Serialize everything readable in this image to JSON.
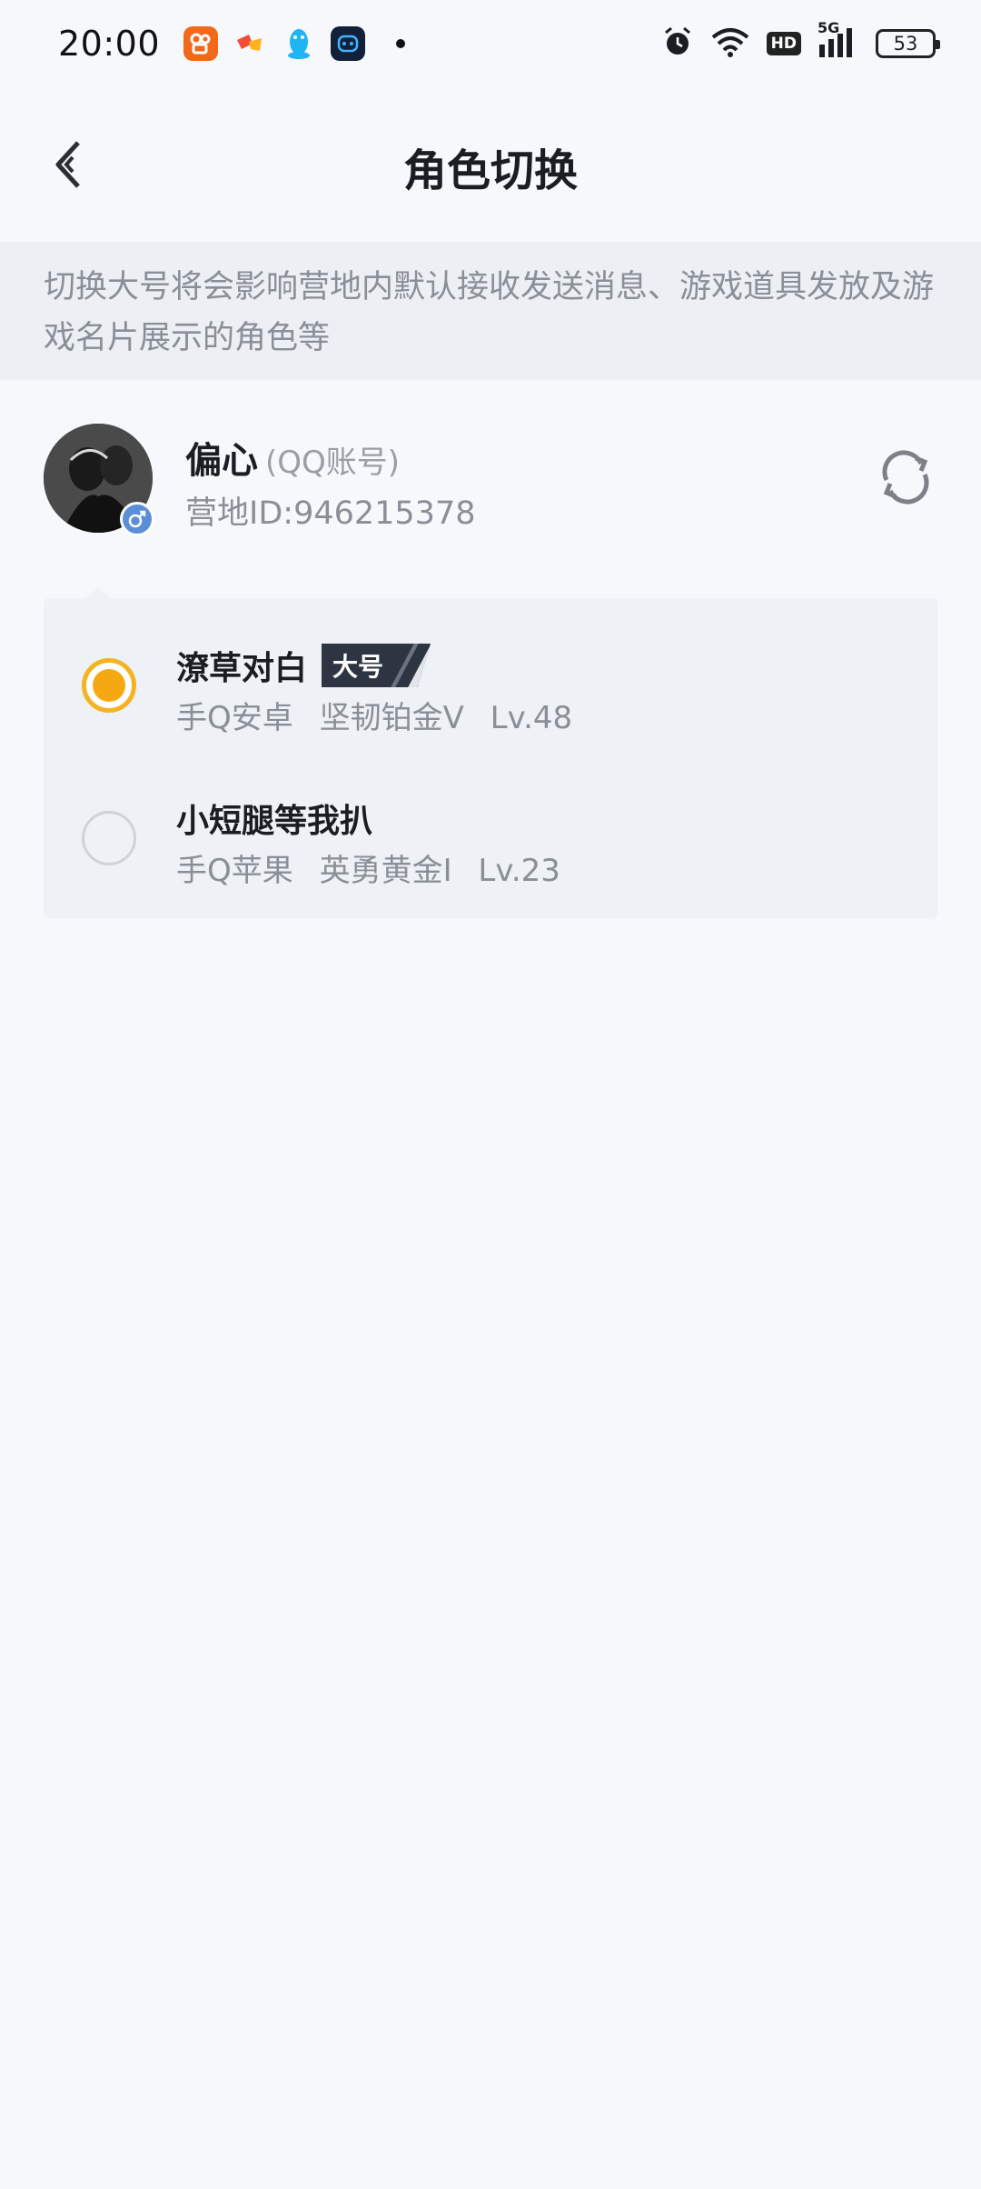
{
  "status_bar": {
    "time": "20:00",
    "battery": "53",
    "network": "5G",
    "hd": "HD",
    "app_icons": [
      "kuaishou-icon",
      "game-icon",
      "qq-penguin-icon",
      "robot-app-icon"
    ]
  },
  "header": {
    "title": "角色切换",
    "back_icon": "chevron-left-icon"
  },
  "notice": {
    "text": "切换大号将会影响营地内默认接收发送消息、游戏道具发放及游戏名片展示的角色等"
  },
  "account": {
    "nickname": "偏心",
    "account_type": "(QQ账号)",
    "camp_id": "营地ID:946215378",
    "gender_icon": "male-icon",
    "switch_icon": "refresh-icon"
  },
  "roles": [
    {
      "name": "潦草对白",
      "badge": "大号",
      "platform": "手Q安卓",
      "rank": "坚韧铂金V",
      "level": "Lv.48",
      "selected": true
    },
    {
      "name": "小短腿等我扒",
      "badge": "",
      "platform": "手Q苹果",
      "rank": "英勇黄金I",
      "level": "Lv.23",
      "selected": false
    }
  ],
  "colors": {
    "accent": "#f6a811",
    "background": "#f6f8fb",
    "notice_bg": "#eceff3",
    "card_bg": "#eef1f5",
    "badge_bg": "#2e3542"
  }
}
